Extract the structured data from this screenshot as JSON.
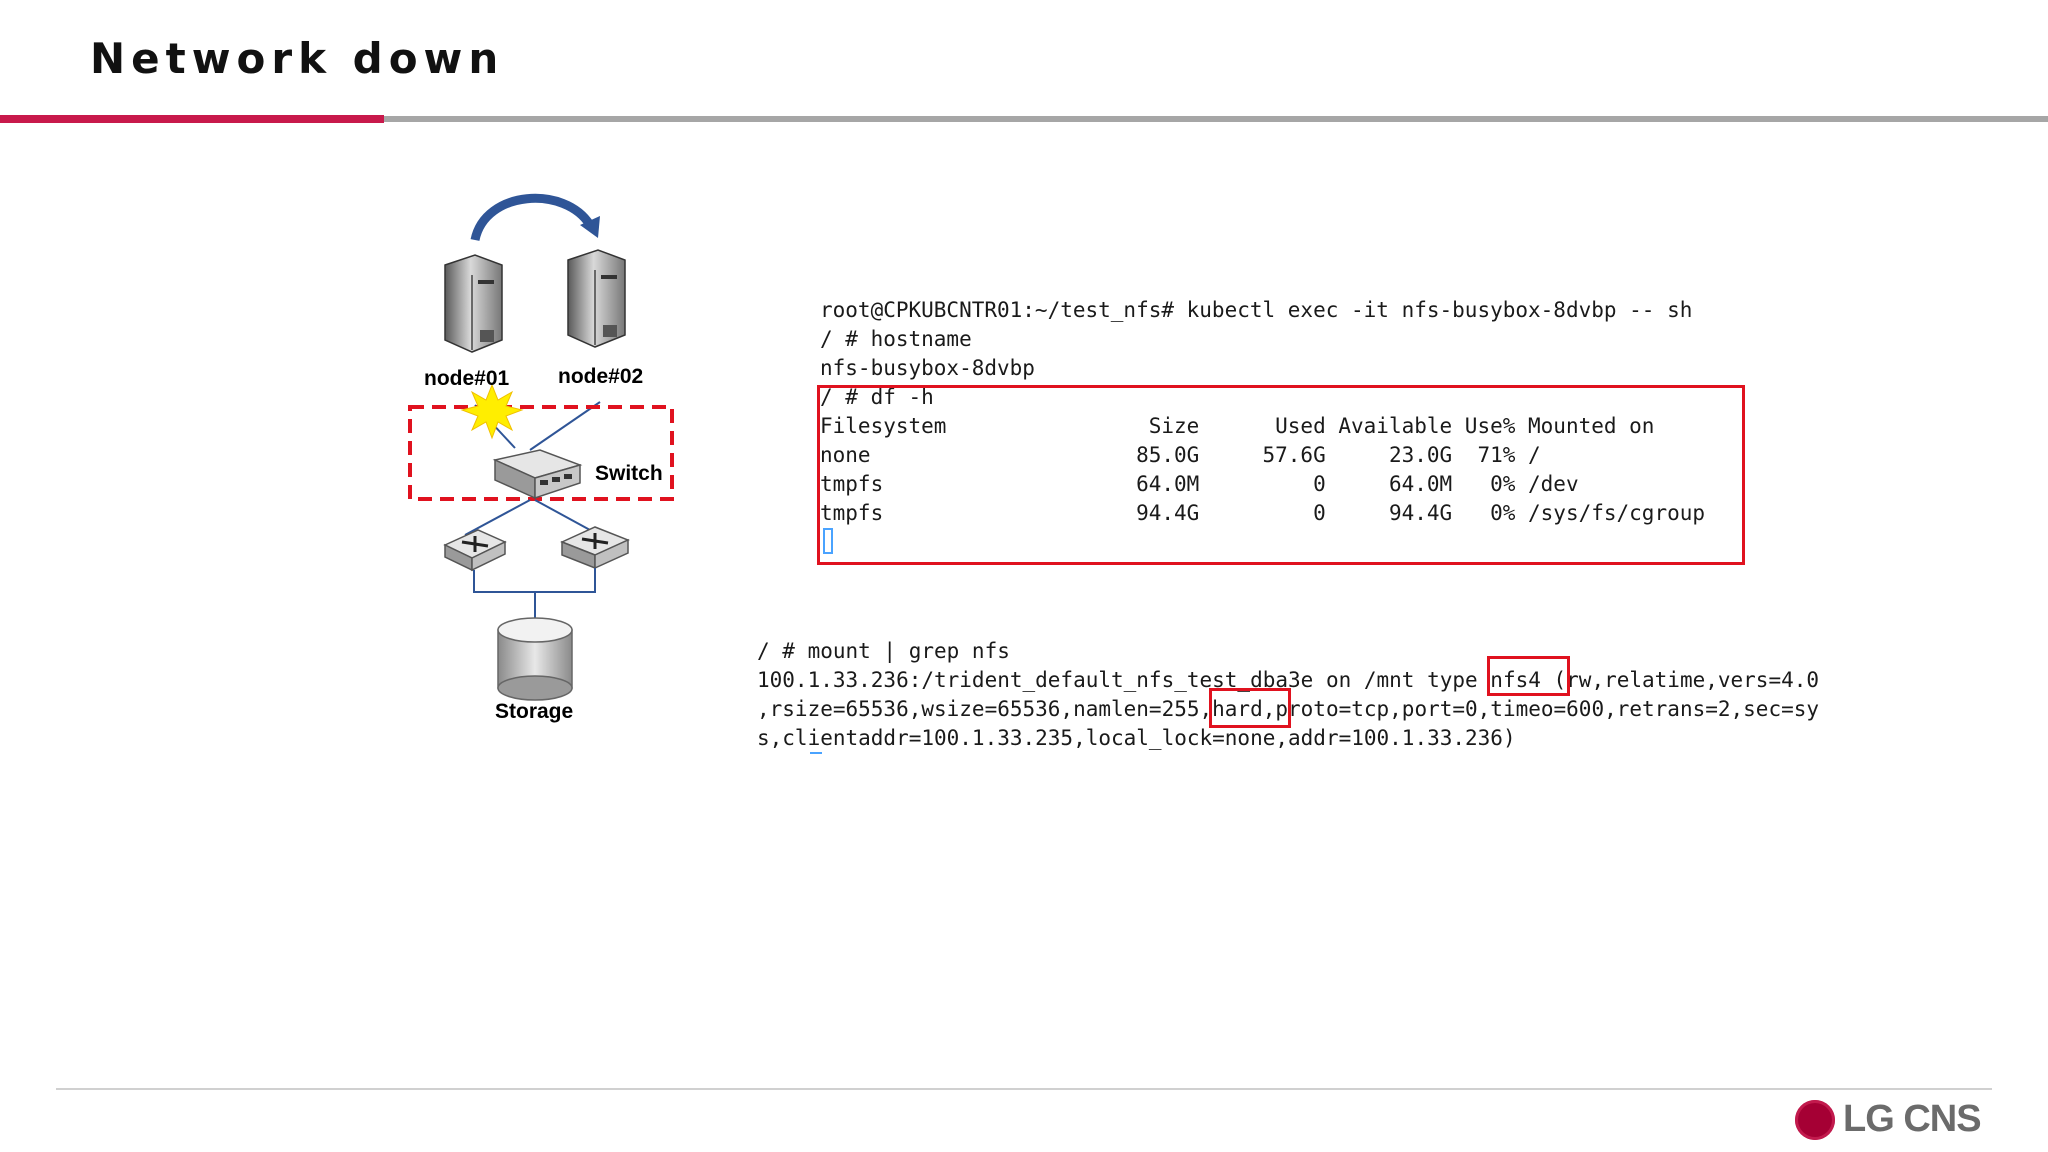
{
  "slide": {
    "title": "Network down"
  },
  "diagram": {
    "node1_label": "node#01",
    "node2_label": "node#02",
    "switch_label": "Switch",
    "storage_label": "Storage"
  },
  "terminal_top": {
    "lines": [
      "root@CPKUBCNTR01:~/test_nfs# kubectl exec -it nfs-busybox-8dvbp -- sh",
      "/ # hostname",
      "nfs-busybox-8dvbp",
      "/ # df -h",
      "Filesystem                Size      Used Available Use% Mounted on",
      "none                     85.0G     57.6G     23.0G  71% /",
      "tmpfs                    64.0M         0     64.0M   0% /dev",
      "tmpfs                    94.4G         0     94.4G   0% /sys/fs/cgroup"
    ]
  },
  "terminal_bottom": {
    "lines": [
      "/ # mount | grep nfs",
      "100.1.33.236:/trident_default_nfs_test_dba3e on /mnt type nfs4 (rw,relatime,vers=4.0",
      ",rsize=65536,wsize=65536,namlen=255,hard,proto=tcp,port=0,timeo=600,retrans=2,sec=sy",
      "s,clientaddr=100.1.33.235,local_lock=none,addr=100.1.33.236)"
    ]
  },
  "logo": {
    "text": "LG CNS"
  },
  "colors": {
    "accent": "#c8194b",
    "highlight": "#e0121f",
    "switch_box": "#e0121f",
    "arrow": "#2f5597"
  }
}
